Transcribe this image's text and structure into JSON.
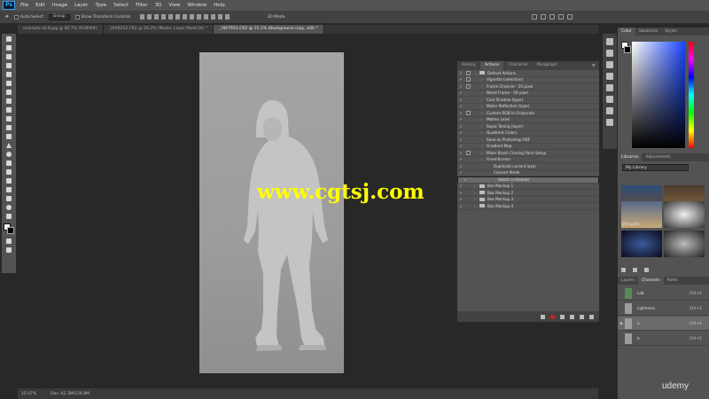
{
  "app": {
    "logo": "Ps"
  },
  "menu": [
    "File",
    "Edit",
    "Image",
    "Layer",
    "Type",
    "Select",
    "Filter",
    "3D",
    "View",
    "Window",
    "Help"
  ],
  "options": {
    "auto_select": "Auto-Select",
    "group": "Group",
    "show_transform": "Show Transform Controls",
    "mode_3d": "3D Mode"
  },
  "tabs": [
    {
      "label": "example-oil-8.jpg @ 66.7% (RGB/8#)",
      "active": false
    },
    {
      "label": "_HIA9252.CR2 @ 26.2% (Model, Layer Mask/16) *",
      "active": false
    },
    {
      "label": "_HIA7651.CR2 @ 15.1% (Background copy, a/8) *",
      "active": true
    }
  ],
  "status": {
    "zoom": "15.07%",
    "doc": "Doc: 62.3M/126.8M"
  },
  "actions_panel": {
    "tabs": [
      "History",
      "Actions",
      "Character",
      "Paragraph"
    ],
    "active_tab": "Actions",
    "items": [
      {
        "label": "Default Actions",
        "type": "folder",
        "dialog": true
      },
      {
        "label": "Vignette (selection)",
        "type": "action",
        "dialog": true
      },
      {
        "label": "Frame Channel - 50 pixel",
        "type": "action",
        "dialog": true
      },
      {
        "label": "Wood Frame - 50 pixel",
        "type": "action",
        "dialog": false
      },
      {
        "label": "Cast Shadow (type)",
        "type": "action",
        "dialog": false
      },
      {
        "label": "Water Reflection (type)",
        "type": "action",
        "dialog": false
      },
      {
        "label": "Custom RGB to Grayscale",
        "type": "action",
        "dialog": true
      },
      {
        "label": "Molten Lead",
        "type": "action",
        "dialog": false
      },
      {
        "label": "Sepia Toning (layer)",
        "type": "action",
        "dialog": false
      },
      {
        "label": "Quadrant Colors",
        "type": "action",
        "dialog": false
      },
      {
        "label": "Save as Photoshop PDF",
        "type": "action",
        "dialog": false
      },
      {
        "label": "Gradient Map",
        "type": "action",
        "dialog": false
      },
      {
        "label": "Mixer Brush Cloning Paint Setup",
        "type": "action",
        "dialog": true
      },
      {
        "label": "GreenScreen",
        "type": "action",
        "dialog": false
      },
      {
        "label": "Duplicate current layer",
        "type": "step",
        "dialog": false
      },
      {
        "label": "Convert Mode",
        "type": "step",
        "dialog": false
      },
      {
        "label": "Select a channel",
        "type": "step",
        "dialog": false,
        "selected": true
      },
      {
        "label": "Box Mockup 1",
        "type": "folder",
        "dialog": false
      },
      {
        "label": "Box Mockup 2",
        "type": "folder",
        "dialog": false
      },
      {
        "label": "Box Mockup 3",
        "type": "folder",
        "dialog": false
      },
      {
        "label": "Box Mockup 4",
        "type": "folder",
        "dialog": false
      }
    ]
  },
  "color_panel": {
    "tabs": [
      "Color",
      "Swatches",
      "Styles"
    ]
  },
  "libraries_panel": {
    "tabs": [
      "Libraries",
      "Adjustments"
    ],
    "library": "My Library",
    "thumb_label": "Old walls"
  },
  "channels_panel": {
    "tabs": [
      "Layers",
      "Channels",
      "Paths"
    ],
    "rows": [
      {
        "name": "Lab",
        "shortcut": "Ctrl+2",
        "visible": false,
        "active": false
      },
      {
        "name": "Lightness",
        "shortcut": "Ctrl+3",
        "visible": false,
        "active": false
      },
      {
        "name": "a",
        "shortcut": "Ctrl+4",
        "visible": true,
        "active": true
      },
      {
        "name": "b",
        "shortcut": "Ctrl+5",
        "visible": false,
        "active": false
      }
    ]
  },
  "watermark": "www.cgtsj.com",
  "brand": "udemy"
}
